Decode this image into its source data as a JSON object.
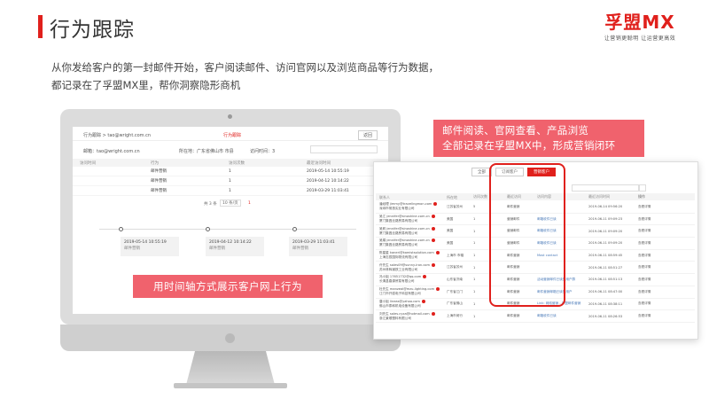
{
  "page": {
    "title": "行为跟踪",
    "intro_line1": "从你发给客户的第一封邮件开始，客户阅读邮件、访问官网以及浏览商品等行为数据，",
    "intro_line2": "都记录在了孚盟MX里，帮你洞察隐形商机"
  },
  "logo": {
    "name": "孚盟MX",
    "slogan": "让营销更聪明 让运营更高效"
  },
  "callouts": {
    "timeline": "用时间轴方式展示客户网上行为",
    "panel_line1": "邮件阅读、官网查看、产品浏览",
    "panel_line2": "全部记录在孚盟MX中，形成营销闭环"
  },
  "screen": {
    "breadcrumb": "行为跟踪 > tao@wright.com.cn",
    "active_tab": "行为跟踪",
    "back_button": "返回",
    "info": {
      "email": "邮箱：tao@wright.com.cn",
      "company": "所在地：广东省佛山市 市县",
      "location": "访问时间：3",
      "search_placeholder": ""
    },
    "columns": [
      "访问时间",
      "行为",
      "访问次数",
      "最近访问时间"
    ],
    "rows": [
      {
        "c1": "",
        "c2": "邮件营销",
        "c3": "1",
        "c4": "2019-05-14 10:55:19"
      },
      {
        "c1": "",
        "c2": "邮件营销",
        "c3": "1",
        "c4": "2019-04-12 10:14:22"
      },
      {
        "c1": "",
        "c2": "邮件营销",
        "c3": "1",
        "c4": "2019-03-29 11:03:41"
      }
    ],
    "pager": {
      "total": "共 3 条",
      "per_page": "10 条/页",
      "page": "1"
    },
    "timeline": [
      {
        "time": "2019-05-14 10:55:19",
        "label": "邮件营销"
      },
      {
        "time": "2019-04-12 10:14:22",
        "label": "邮件营销"
      },
      {
        "time": "2019-03-29 11:03:41",
        "label": "邮件营销"
      }
    ]
  },
  "panel": {
    "tabs": [
      "全部",
      "订阅客户",
      "营销客户"
    ],
    "columns": [
      "联系人",
      "所在地",
      "访问次数",
      "行为",
      "最近访问",
      "访问内容",
      "最近访问时间",
      "操作"
    ],
    "rows": [
      {
        "contact": "潘经理 jimmy@travelingmon.com",
        "company": "深圳市常旅实业有限公司",
        "loc": "江苏省苏州",
        "n": "5",
        "act": "邮件营销",
        "channel": "邮件营销",
        "content": "",
        "time": "2019-06-14 09:56:20",
        "op": "查看详情"
      },
      {
        "contact": "吴江 jennifer@sinoshine.com.cn",
        "company": "厦门集昌丝路贸易有限公司",
        "loc": "美国",
        "n": "1",
        "act": "营销邮件",
        "channel": "营销邮件",
        "content": "邮箱收件已读",
        "time": "2019-06-11 09:09:23",
        "op": "查看详情"
      },
      {
        "contact": "吴莉 jennifer@sinoshine.com.cn",
        "company": "厦门集昌丝路贸易有限公司",
        "loc": "美国",
        "n": "1",
        "act": "营销邮件",
        "channel": "营销邮件",
        "content": "邮箱收件已读",
        "time": "2019-06-11 09:09:20",
        "op": "查看详情"
      },
      {
        "contact": "吴娟 jennifer@sinoshine.com.cn",
        "company": "厦门集昌丝路贸易有限公司",
        "loc": "美国",
        "n": "1",
        "act": "营销邮件",
        "channel": "营销邮件",
        "content": "邮箱收件已读",
        "time": "2019-06-11 09:09:20",
        "op": "查看详情"
      },
      {
        "contact": "陈星星 kaneri@kamistsolution.com",
        "company": "上海志辰国际物流有限公司",
        "loc": "上海市 市辖",
        "n": "1",
        "act": "邮件营销",
        "channel": "邮件营销",
        "content": "Most contact",
        "time": "2019-06-11 08:59:45",
        "op": "查看详情"
      },
      {
        "contact": "许先生 sales09@sunny-iron.com",
        "company": "苏州林辉钢铁工业有限公司",
        "loc": "江苏省苏州",
        "n": "1",
        "act": "邮件营销",
        "channel": "邮件营销",
        "content": "",
        "time": "2019-06-11 08:51:27",
        "op": "查看详情"
      },
      {
        "contact": "冯小姐 17651732@qq.com",
        "company": "长清县春源贸易有限公司",
        "loc": "山东省济南",
        "n": "1",
        "act": "邮件营销",
        "channel": "邮件营销",
        "content": "活动营销邮件已读的用户群",
        "time": "2019-06-11 08:51:13",
        "op": "查看详情"
      },
      {
        "contact": "杜先生 manzeal@mzu-lighting.com",
        "company": "江门市开弧电子科技有限公司",
        "loc": "广东省江门",
        "n": "1",
        "act": "邮件营销",
        "channel": "邮件营销",
        "content": "邮件营销邮箱已读的用户",
        "time": "2019-06-11 08:47:00",
        "op": "查看详情"
      },
      {
        "contact": "唐小姐 lineas@yahoo.com",
        "company": "佛山市泰和机电设备有限公司",
        "loc": "广东省佛山",
        "n": "1",
        "act": "邮件营销",
        "channel": "邮件营销",
        "content": "Link: 网络营销 - 孚盟邮件营销",
        "time": "2019-06-11 08:38:11",
        "op": "查看详情"
      },
      {
        "contact": "刘先生 sales.cyxa@hotmail.com",
        "company": "浙江景顺塑料有限公司",
        "loc": "上海市闵行",
        "n": "1",
        "act": "邮件营销",
        "channel": "邮件营销",
        "content": "邮箱收件已读",
        "time": "2019-06-11 08:26:53",
        "op": "查看详情"
      }
    ]
  },
  "colors": {
    "accent": "#e0201c",
    "callout": "#f0626d"
  }
}
